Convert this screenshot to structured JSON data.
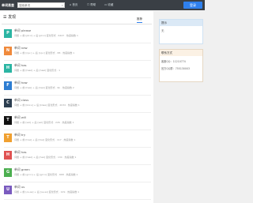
{
  "header": {
    "brand": "单词易查",
    "search_placeholder": "搜索单词",
    "nav": [
      "首页",
      "帮助",
      "收藏"
    ],
    "login": "登录"
  },
  "main": {
    "title": "发现",
    "tab": "推荐",
    "items": [
      {
        "letter": "P",
        "color": "#2bb5a3",
        "word": "单词 please",
        "meta": "词根 + 前 [pli:z] + 后 [pli:z] 变化形式 · 6447 · 热度指数 1"
      },
      {
        "letter": "N",
        "color": "#f08a3c",
        "word": "单词 new",
        "meta": "词根 + 前 [nju:] + 后 [nju:] 变化形式 · 88 · 热度指数 1"
      },
      {
        "letter": "H",
        "color": "#2bb5a3",
        "word": "单词 has",
        "meta": "词根 + 前 [hæz] + 后 [hæz] 变化形式 · 1"
      },
      {
        "letter": "F",
        "color": "#2d7dd2",
        "word": "单词 how",
        "meta": "词根 + 前 [haʊ] + 后 [haʊ] 变化形式 · 9k · 热度指数 2"
      },
      {
        "letter": "C",
        "color": "#2c3e50",
        "word": "单词 class",
        "meta": "词根 + 前 [klɑ:s] + 后 [klæs] 变化形式 · 2034 · 热度指数 1"
      },
      {
        "letter": "T",
        "color": "#111111",
        "word": "单词 will",
        "meta": "词根 + 前 [wɪl] + 后 [wɪl] 变化形式 · 226 · 热度指数 1"
      },
      {
        "letter": "T",
        "color": "#f0a030",
        "word": "单词 try",
        "meta": "词根 + 前 [traɪ] + 后 [traɪ] 变化形式 · 117 · 热度指数 1"
      },
      {
        "letter": "H",
        "color": "#e05252",
        "word": "单词 has",
        "meta": "词根 + 前 [hæz] + 后 [həz] 变化形式 · 134 · 热度指数 1"
      },
      {
        "letter": "G",
        "color": "#4caf50",
        "word": "单词 green",
        "meta": "词根 + 前 [gri:n] + 后 [gri:n] 变化形式 · 668 · 热度指数 1"
      },
      {
        "letter": "U",
        "color": "#7a5bbf",
        "word": "单词 us",
        "meta": "词根 + 前 [ʌs,əs] + 后 [ʌs,əs] 变化形式 · 129 · 热度指数 1"
      }
    ]
  },
  "sidebar": {
    "box1_title": "提示",
    "box1_row": "无",
    "box2_title": "联系方式",
    "box2_rows": [
      "客服QQ：11210774",
      "官方QQ群：755130003"
    ]
  }
}
